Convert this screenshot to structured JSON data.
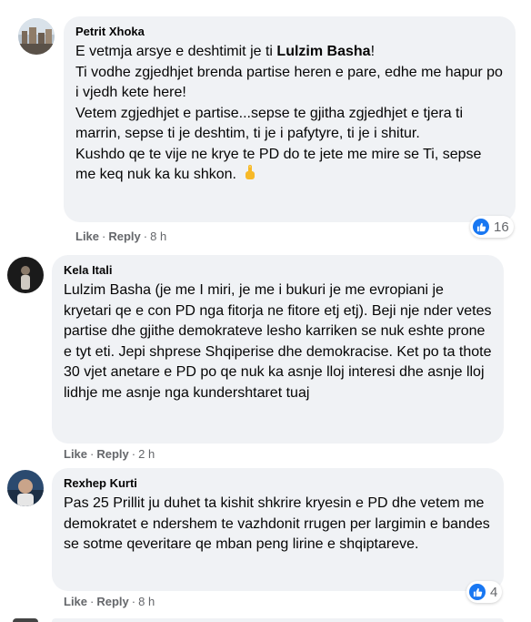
{
  "comments": [
    {
      "author": "Petrit Xhoka",
      "text_before": "E vetmja arsye e deshtimit je ti ",
      "text_bold": "Lulzim Basha",
      "text_after": "!",
      "lines": [
        "Ti vodhe zgjedhjet brenda partise heren e pare, edhe me hapur po i vjedh kete here!",
        "Vetem zgjedhjet e partise...sepse te gjitha zgjedhjet e tjera ti marrin, sepse ti je deshtim, ti je i pafytyre, ti je i shitur.",
        "Kushdo qe te vije ne krye te PD do te jete me mire se Ti, sepse me keq nuk ka ku shkon."
      ],
      "emoji": "pointing-up-emoji",
      "like_label": "Like",
      "reply_label": "Reply",
      "time": "8 h",
      "reaction_count": "16"
    },
    {
      "author": "Kela Itali",
      "text": "Lulzim Basha (je me I miri, je me i bukuri je me evropiani je kryetari qe e con PD nga fitorja ne fitore etj etj). Beji nje nder vetes partise dhe gjithe demokrateve lesho karriken se nuk eshte prone e tyt eti. Jepi shprese Shqiperise dhe demokracise. Ket po ta thote 30 vjet anetare e PD po qe nuk ka asnje lloj interesi dhe asnje lloj lidhje me asnje nga kundershtaret tuaj",
      "like_label": "Like",
      "reply_label": "Reply",
      "time": "2 h"
    },
    {
      "author": "Rexhep Kurti",
      "text": "Pas 25 Prillit ju duhet ta kishit shkrire kryesin e PD dhe vetem me demokratet e ndershem te vazhdonit rrugen per largimin e bandes se sotme qeveritare qe mban peng lirine e shqiptareve.",
      "like_label": "Like",
      "reply_label": "Reply",
      "time": "8 h",
      "reaction_count": "4"
    }
  ],
  "separator": "·",
  "colors": {
    "bubble": "#f0f2f5",
    "meta": "#65676b",
    "like_blue": "#1877f2",
    "emoji": "#f7b928"
  }
}
